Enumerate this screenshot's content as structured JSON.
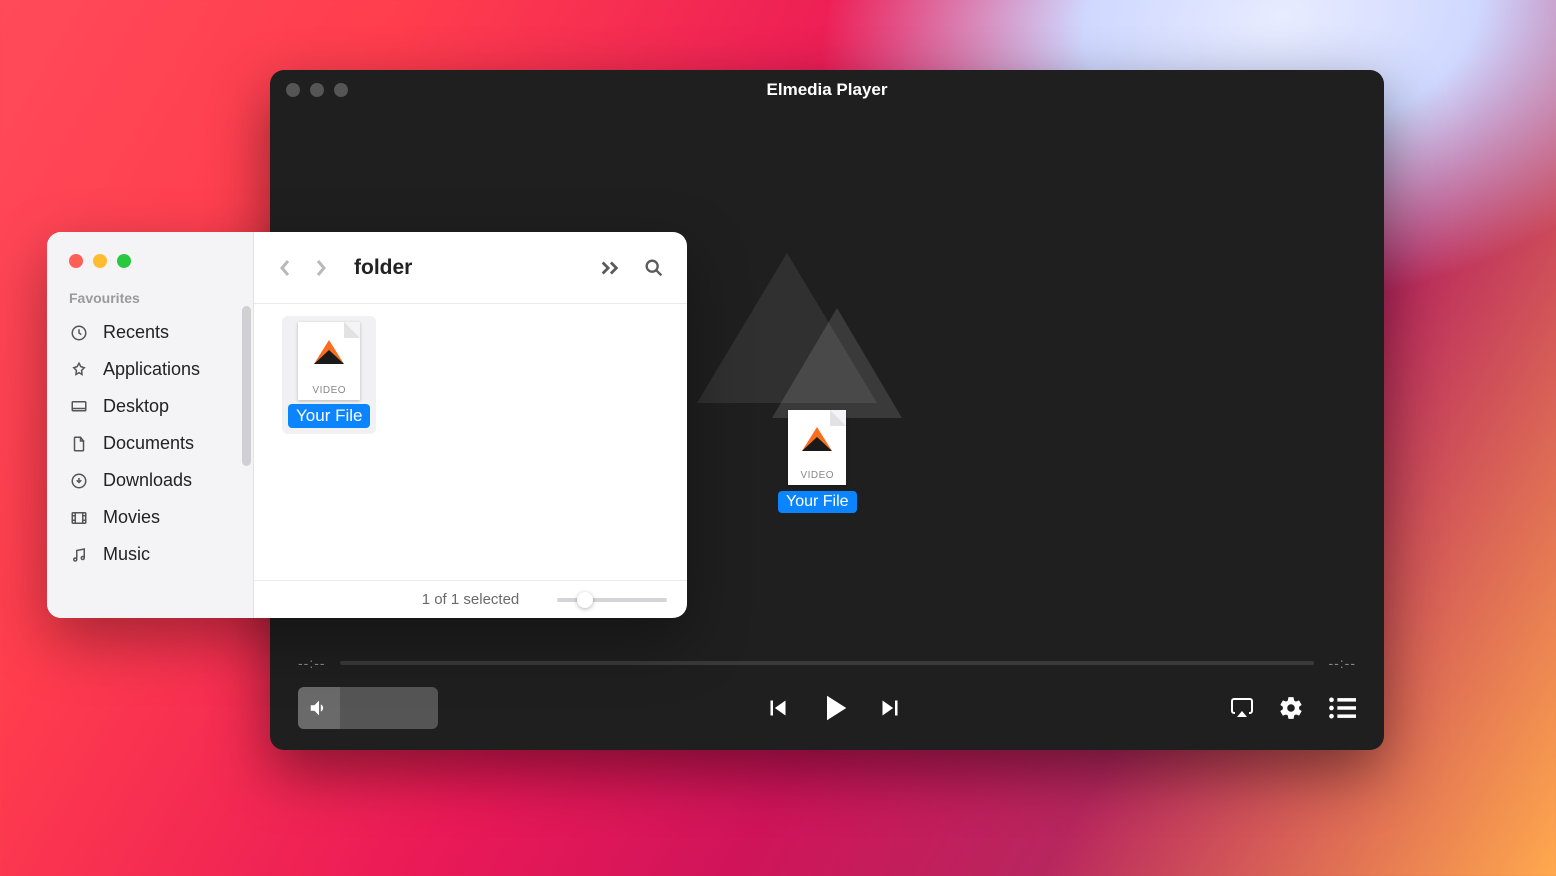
{
  "player": {
    "title": "Elmedia Player",
    "time_left": "--:--",
    "time_right": "--:--",
    "drop_file_label": "Your File",
    "drop_file_type": "VIDEO"
  },
  "finder": {
    "folder_title": "folder",
    "favourites_heading": "Favourites",
    "sidebar": {
      "items": [
        {
          "label": "Recents",
          "icon": "clock-icon"
        },
        {
          "label": "Applications",
          "icon": "apps-icon"
        },
        {
          "label": "Desktop",
          "icon": "desktop-icon"
        },
        {
          "label": "Documents",
          "icon": "document-icon"
        },
        {
          "label": "Downloads",
          "icon": "download-icon"
        },
        {
          "label": "Movies",
          "icon": "movies-icon"
        },
        {
          "label": "Music",
          "icon": "music-icon"
        }
      ]
    },
    "file": {
      "label": "Your File",
      "type": "VIDEO"
    },
    "status_text": "1 of 1 selected"
  }
}
